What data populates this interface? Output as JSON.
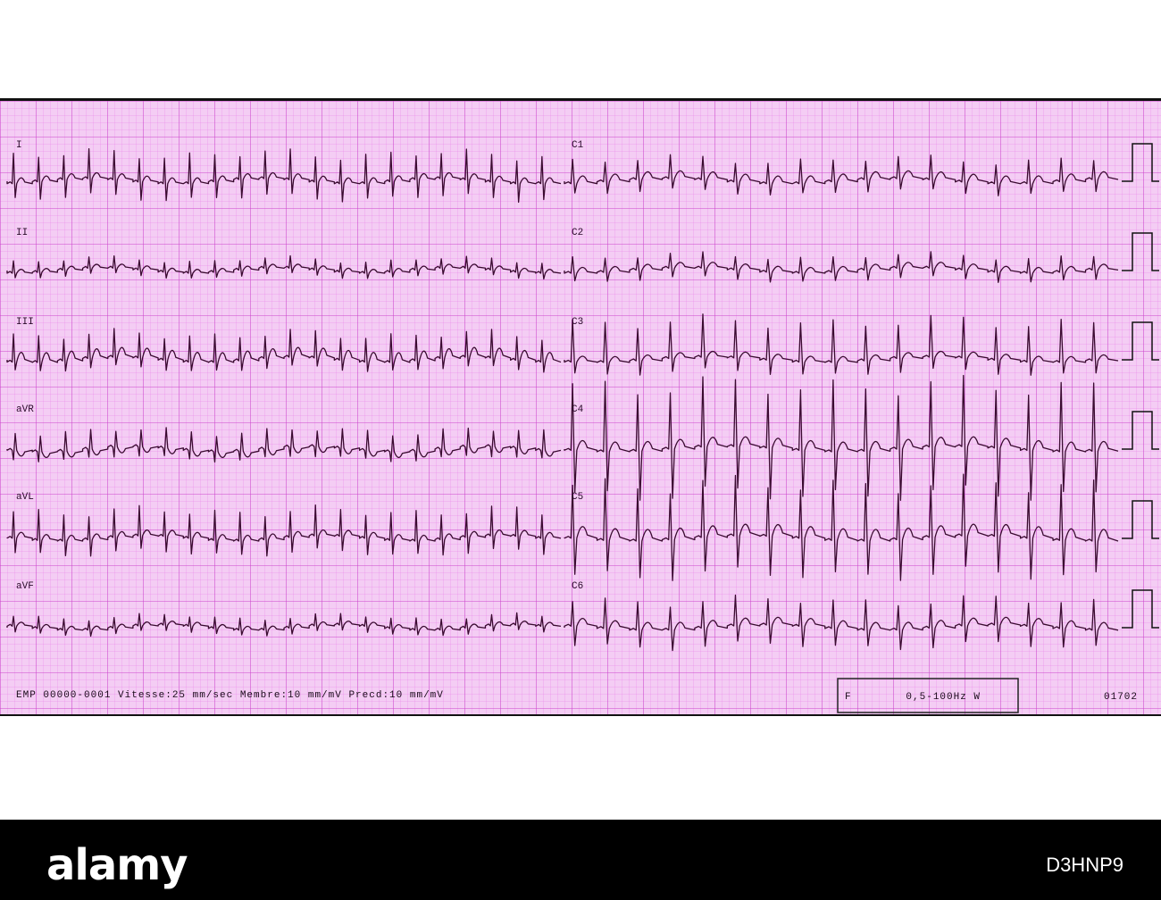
{
  "ecg": {
    "leads_left": [
      "I",
      "II",
      "III",
      "aVR",
      "aVL",
      "aVF"
    ],
    "leads_right": [
      "C1",
      "C2",
      "C3",
      "C4",
      "C5",
      "C6"
    ],
    "info_line": "EMP 00000-0001   Vitesse:25 mm/sec Membre:10 mm/mV Precd:10 mm/mV",
    "filter_box": "F        0,5-100Hz W",
    "page_number": "01702",
    "grid_color": "#e060e0",
    "trace_color": "#3a0a30",
    "paper_color": "#f2c8f2"
  },
  "watermark": {
    "logo": "alamy",
    "image_id": "D3HNP9"
  }
}
